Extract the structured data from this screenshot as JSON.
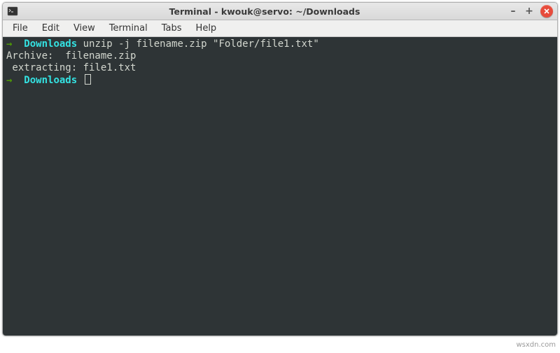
{
  "titlebar": {
    "title": "Terminal - kwouk@servo: ~/Downloads"
  },
  "menubar": {
    "items": [
      "File",
      "Edit",
      "View",
      "Terminal",
      "Tabs",
      "Help"
    ]
  },
  "terminal": {
    "prompt_arrow": "→",
    "prompt_dir": "Downloads",
    "lines": {
      "l1_cmd": "unzip -j filename.zip \"Folder/file1.txt\"",
      "l2": "Archive:  filename.zip",
      "l3": " extracting: file1.txt"
    }
  },
  "watermark": "wsxdn.com"
}
